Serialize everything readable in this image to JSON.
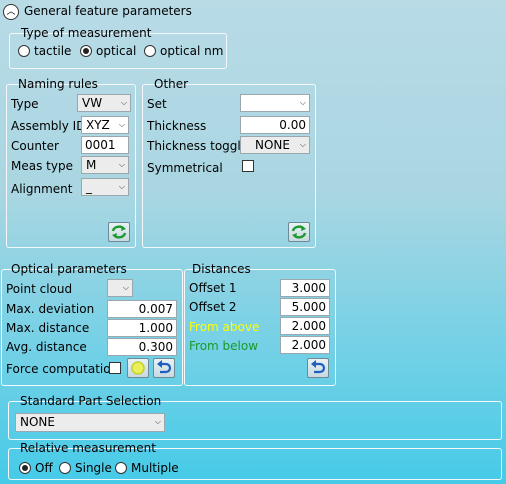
{
  "header": {
    "title": "General feature parameters",
    "toggle_icon": "chevron-up-icon"
  },
  "type_of_measurement": {
    "legend": "Type of measurement",
    "options": [
      {
        "label": "tactile",
        "selected": false
      },
      {
        "label": "optical",
        "selected": true
      },
      {
        "label": "optical nm",
        "selected": false
      }
    ]
  },
  "naming_rules": {
    "legend": "Naming rules",
    "type_label": "Type",
    "type_value": "VW",
    "assembly_label": "Assembly ID",
    "assembly_value": "XYZ",
    "counter_label": "Counter",
    "counter_value": "0001",
    "meas_type_label": "Meas type",
    "meas_type_value": "M",
    "alignment_label": "Alignment",
    "alignment_value": "_",
    "refresh_icon": "refresh-icon"
  },
  "other": {
    "legend": "Other",
    "set_label": "Set",
    "set_value": "",
    "thickness_label": "Thickness",
    "thickness_value": "0.00",
    "thickness_toggle_label": "Thickness toggle",
    "thickness_toggle_value": "NONE",
    "symmetrical_label": "Symmetrical",
    "symmetrical_checked": false,
    "refresh_icon": "refresh-icon"
  },
  "optical_parameters": {
    "legend": "Optical parameters",
    "point_cloud_label": "Point cloud",
    "point_cloud_value": "",
    "max_deviation_label": "Max. deviation",
    "max_deviation_value": "0.007",
    "max_distance_label": "Max. distance",
    "max_distance_value": "1.000",
    "avg_distance_label": "Avg. distance",
    "avg_distance_value": "0.300",
    "force_computation_label": "Force computation",
    "force_computation_checked": false,
    "status_icon": "status-light-icon",
    "undo_icon": "undo-icon"
  },
  "distances": {
    "legend": "Distances",
    "offset1_label": "Offset 1",
    "offset1_value": "3.000",
    "offset2_label": "Offset 2",
    "offset2_value": "5.000",
    "from_above_label": "From above",
    "from_above_value": "2.000",
    "from_above_color": "#ffff00",
    "from_below_label": "From below",
    "from_below_value": "2.000",
    "from_below_color": "#1a9a2a",
    "undo_icon": "undo-icon"
  },
  "standard_part": {
    "legend": "Standard Part Selection",
    "value": "NONE"
  },
  "relative_measurement": {
    "legend": "Relative measurement",
    "options": [
      {
        "label": "Off",
        "selected": true
      },
      {
        "label": "Single",
        "selected": false
      },
      {
        "label": "Multiple",
        "selected": false
      }
    ]
  }
}
